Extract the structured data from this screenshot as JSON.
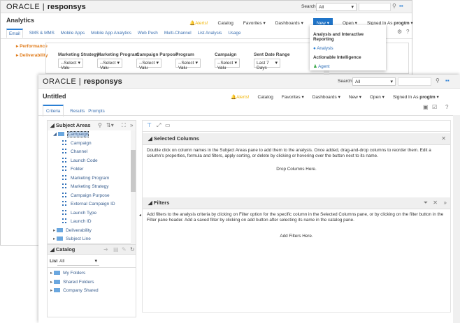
{
  "back_window": {
    "logo": {
      "brand": "ORACLE",
      "product": "responsys"
    },
    "search_label": "Search",
    "search_scope": "All",
    "title": "Analytics",
    "nav": {
      "alerts": "Alerts!",
      "catalog": "Catalog",
      "favorites": "Favorites",
      "dashboards": "Dashboards",
      "new": "New",
      "open": "Open",
      "signed_in_as": "Signed In As",
      "user": "progtm"
    },
    "tabs": [
      "Email",
      "SMS & MMS",
      "Mobile Apps",
      "Mobile App Analytics",
      "Web Push",
      "Multi-Channel",
      "List Analysis",
      "Usage"
    ],
    "side_links": [
      "Performance",
      "Deliverability"
    ],
    "filters": [
      {
        "label": "Marketing Strategy",
        "value": "--Select Valu"
      },
      {
        "label": "Marketing Program",
        "value": "--Select Valu"
      },
      {
        "label": "Campaign Purpose",
        "value": "--Select Valu"
      },
      {
        "label": "Program",
        "value": "--Select Valu"
      },
      {
        "label": "Campaign",
        "value": "--Select Valu"
      },
      {
        "label": "Sent Date Range",
        "value": "Last 7 Days"
      }
    ],
    "new_menu": {
      "section1": "Analysis and Interactive Reporting",
      "item1": "Analysis",
      "section2": "Actionable Intelligence",
      "item2": "Agent"
    }
  },
  "front_window": {
    "logo": {
      "brand": "ORACLE",
      "product": "responsys"
    },
    "search_label": "Search",
    "search_scope": "All",
    "title": "Untitled",
    "nav": {
      "alerts": "Alerts!",
      "catalog": "Catalog",
      "favorites": "Favorites",
      "dashboards": "Dashboards",
      "new": "New",
      "open": "Open",
      "signed_in_as": "Signed In As",
      "user": "progtm"
    },
    "tabs": [
      "Criteria",
      "Results",
      "Prompts"
    ],
    "subject_areas": {
      "title": "Subject Areas",
      "folder": "Campaign",
      "columns": [
        "Campaign",
        "Channel",
        "Launch Code",
        "Folder",
        "Marketing Program",
        "Marketing Strategy",
        "Campaign Purpose",
        "External Campaign ID",
        "Launch Type",
        "Launch ID"
      ],
      "other_folders": [
        "Deliverability",
        "Subject Line"
      ]
    },
    "catalog": {
      "title": "Catalog",
      "list_label": "List",
      "list_value": "All",
      "folders": [
        "My Folders",
        "Shared Folders",
        "Company Shared"
      ]
    },
    "selected_columns": {
      "title": "Selected Columns",
      "description": "Double click on column names in the Subject Areas pane to add them to the analysis. Once added, drag-and-drop columns to reorder them. Edit a column's properties, formula and filters, apply sorting, or delete by clicking or hovering over the button next to its name.",
      "drop_text": "Drop Columns Here."
    },
    "filters": {
      "title": "Filters",
      "description": "Add filters to the analysis criteria by clicking on Filter option for the specific column in the Selected Columns pane, or by clicking on the filter button in the Filter pane header. Add a saved filter by clicking on add button after selecting its name in the catalog pane.",
      "drop_text": "Add Filters Here."
    }
  }
}
